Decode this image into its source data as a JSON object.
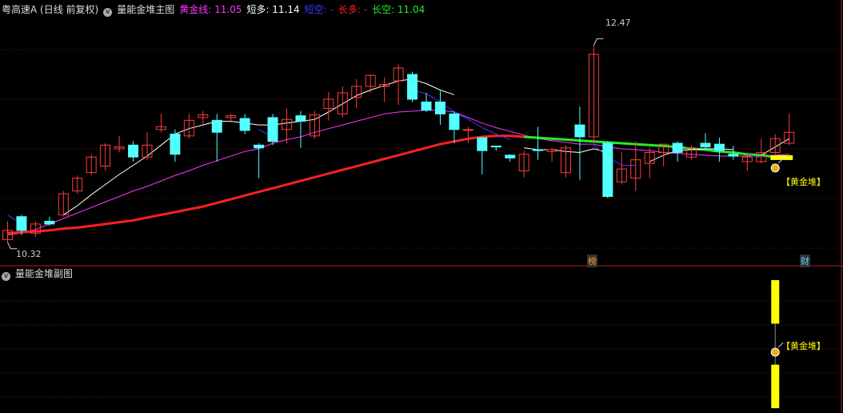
{
  "main_header": {
    "stock": "粤高速A (日线 前复权)",
    "indicator": "量能金堆主图",
    "gold_label": "黄金线: 11.05",
    "short_long_label": "短多: 11.14",
    "short_empty_label": "短空: -",
    "long_long_label": "长多: -",
    "long_empty_label": "长空: 11.04"
  },
  "sub_header": {
    "indicator": "量能金堆副图"
  },
  "annotations": {
    "high_label": "12.47",
    "low_label": "10.32",
    "gold_pile_main": "【黄金堆】",
    "gold_pile_sub": "【黄金堆】",
    "bang_tag": "榜",
    "cai_tag": "财"
  },
  "colors": {
    "up": "#ff3c3c",
    "down": "#54ffff",
    "gold_line": "#ff33ff",
    "short_long": "#ffffff",
    "short_empty": "#3a3aff",
    "long_long": "#ff2020",
    "long_empty": "#22ee22",
    "gold_bar": "#ffff00",
    "grid": "#7a1515"
  },
  "chart_data": {
    "type": "candlestick",
    "y_range": [
      10.1,
      12.7
    ],
    "high": 12.47,
    "low": 10.32,
    "candles": [
      [
        10.35,
        10.45,
        10.32,
        10.55
      ],
      [
        10.6,
        10.45,
        10.4,
        10.62
      ],
      [
        10.42,
        10.52,
        10.38,
        10.55
      ],
      [
        10.55,
        10.52,
        10.5,
        10.6
      ],
      [
        10.62,
        10.85,
        10.6,
        10.88
      ],
      [
        10.88,
        11.02,
        10.85,
        11.05
      ],
      [
        11.08,
        11.25,
        11.05,
        11.28
      ],
      [
        11.15,
        11.38,
        11.1,
        11.4
      ],
      [
        11.34,
        11.36,
        11.3,
        11.48
      ],
      [
        11.38,
        11.25,
        11.2,
        11.42
      ],
      [
        11.25,
        11.38,
        11.22,
        11.52
      ],
      [
        11.55,
        11.58,
        11.52,
        11.72
      ],
      [
        11.5,
        11.28,
        11.2,
        11.55
      ],
      [
        11.48,
        11.65,
        11.45,
        11.72
      ],
      [
        11.68,
        11.71,
        11.6,
        11.75
      ],
      [
        11.65,
        11.52,
        11.2,
        11.72
      ],
      [
        11.68,
        11.7,
        11.62,
        11.72
      ],
      [
        11.67,
        11.54,
        11.5,
        11.72
      ],
      [
        11.38,
        11.35,
        11.02,
        11.4
      ],
      [
        11.68,
        11.42,
        11.38,
        11.72
      ],
      [
        11.55,
        11.66,
        11.4,
        11.78
      ],
      [
        11.7,
        11.64,
        11.35,
        11.75
      ],
      [
        11.48,
        11.71,
        11.45,
        11.75
      ],
      [
        11.78,
        11.88,
        11.65,
        11.96
      ],
      [
        11.72,
        11.95,
        11.68,
        12.02
      ],
      [
        11.9,
        12.02,
        11.78,
        12.1
      ],
      [
        12.02,
        12.14,
        11.95,
        12.15
      ],
      [
        12.02,
        12.04,
        11.85,
        12.12
      ],
      [
        12.08,
        12.22,
        11.82,
        12.26
      ],
      [
        12.15,
        11.88,
        11.85,
        12.18
      ],
      [
        11.85,
        11.76,
        11.74,
        11.95
      ],
      [
        11.85,
        11.72,
        11.6,
        11.97
      ],
      [
        11.72,
        11.55,
        11.4,
        11.75
      ],
      [
        11.55,
        11.55,
        11.4,
        11.58
      ],
      [
        11.46,
        11.32,
        11.06,
        11.47
      ],
      [
        11.37,
        11.36,
        11.32,
        11.37
      ],
      [
        11.27,
        11.24,
        11.2,
        11.28
      ],
      [
        11.1,
        11.28,
        11.03,
        11.32
      ],
      [
        11.33,
        11.32,
        11.22,
        11.58
      ],
      [
        11.31,
        11.33,
        11.2,
        11.35
      ],
      [
        11.08,
        11.35,
        11.03,
        11.38
      ],
      [
        11.6,
        11.47,
        11.0,
        11.8
      ],
      [
        11.47,
        12.37,
        11.4,
        12.47
      ],
      [
        11.4,
        10.82,
        10.8,
        11.42
      ],
      [
        10.98,
        11.12,
        10.95,
        11.3
      ],
      [
        11.02,
        11.22,
        10.88,
        11.42
      ],
      [
        11.18,
        11.3,
        11.02,
        11.36
      ],
      [
        11.3,
        11.39,
        11.15,
        11.38
      ],
      [
        11.4,
        11.3,
        11.2,
        11.42
      ],
      [
        11.25,
        11.35,
        11.22,
        11.38
      ],
      [
        11.4,
        11.36,
        11.32,
        11.51
      ],
      [
        11.39,
        11.32,
        11.2,
        11.46
      ],
      [
        11.28,
        11.26,
        11.22,
        11.37
      ],
      [
        11.2,
        11.25,
        11.1,
        11.3
      ],
      [
        11.2,
        11.3,
        11.18,
        11.45
      ],
      [
        11.3,
        11.45,
        11.28,
        11.5
      ],
      [
        11.4,
        11.52,
        11.38,
        11.72
      ]
    ],
    "series": [
      {
        "name": "黄金线",
        "color": "#ff33ff",
        "width": 1,
        "values": [
          10.4,
          10.42,
          10.46,
          10.52,
          10.58,
          10.64,
          10.7,
          10.76,
          10.82,
          10.88,
          10.93,
          10.99,
          11.05,
          11.1,
          11.16,
          11.21,
          11.26,
          11.31,
          11.34,
          11.4,
          11.44,
          11.47,
          11.52,
          11.56,
          11.6,
          11.64,
          11.68,
          11.72,
          11.74,
          11.75,
          11.76,
          11.76,
          11.74,
          11.68,
          11.62,
          11.57,
          11.53,
          11.49,
          11.45,
          11.43,
          11.41,
          11.39,
          11.39,
          11.36,
          11.34,
          11.33,
          11.32,
          11.3,
          11.29,
          11.28,
          11.27,
          11.26,
          11.26,
          11.26,
          11.26,
          11.27,
          11.28
        ]
      },
      {
        "name": "长多",
        "color": "#ff2020",
        "width": 3,
        "values": [
          10.42,
          10.43,
          10.44,
          10.45,
          10.47,
          10.48,
          10.5,
          10.52,
          10.54,
          10.56,
          10.59,
          10.62,
          10.65,
          10.68,
          10.71,
          10.75,
          10.79,
          10.83,
          10.87,
          10.91,
          10.95,
          10.99,
          11.03,
          11.07,
          11.11,
          11.15,
          11.19,
          11.23,
          11.27,
          11.31,
          11.35,
          11.39,
          11.42,
          11.45,
          11.47,
          11.48,
          11.48,
          11.47
        ]
      },
      {
        "name": "长空",
        "color": "#22ee22",
        "width": 3,
        "values": [
          null,
          null,
          null,
          null,
          null,
          null,
          null,
          null,
          null,
          null,
          null,
          null,
          null,
          null,
          null,
          null,
          null,
          null,
          null,
          null,
          null,
          null,
          null,
          null,
          null,
          null,
          null,
          null,
          null,
          null,
          null,
          null,
          null,
          null,
          null,
          null,
          null,
          11.47,
          11.46,
          11.45,
          11.44,
          11.43,
          11.42,
          11.41,
          11.4,
          11.39,
          11.38,
          11.37,
          11.36,
          11.34,
          11.33,
          11.31,
          11.3,
          11.28,
          11.27,
          11.25,
          11.24
        ]
      },
      {
        "name": "短多",
        "color": "#ffffff",
        "width": 1,
        "values": [
          null,
          null,
          null,
          null,
          10.62,
          10.72,
          10.84,
          10.95,
          11.06,
          11.16,
          11.26,
          11.38,
          11.5,
          11.56,
          11.6,
          11.64,
          11.64,
          11.62,
          11.6,
          11.6,
          11.62,
          11.64,
          11.66,
          11.74,
          11.83,
          11.92,
          11.98,
          12.03,
          12.08,
          12.1,
          12.05,
          11.98,
          11.93,
          null,
          null,
          null,
          null,
          11.35,
          11.33,
          11.33,
          11.31,
          11.3,
          11.34,
          11.3,
          null,
          null,
          11.2,
          11.27,
          11.32,
          11.33,
          11.34,
          11.34,
          11.33,
          null,
          11.27,
          11.36,
          11.45
        ]
      },
      {
        "name": "短空",
        "color": "#3a3aff",
        "width": 1,
        "values": [
          10.62,
          10.52,
          null,
          null,
          null,
          null,
          null,
          null,
          null,
          null,
          null,
          null,
          null,
          null,
          null,
          null,
          null,
          null,
          11.55,
          11.47,
          null,
          null,
          null,
          null,
          null,
          null,
          null,
          null,
          null,
          11.98,
          11.94,
          11.85,
          11.74,
          11.66,
          11.57,
          11.5,
          11.44,
          null,
          null,
          null,
          null,
          null,
          11.38,
          11.25,
          11.16,
          11.16,
          null,
          null,
          null,
          null,
          null,
          null,
          null,
          11.28,
          11.24,
          null,
          null
        ]
      }
    ],
    "sub_bars": [
      {
        "index": 55,
        "from": 0.0,
        "to": 0.34,
        "color": "#ffff00"
      },
      {
        "index": 55,
        "from": 0.66,
        "to": 1.0,
        "color": "#ffff00"
      }
    ]
  }
}
